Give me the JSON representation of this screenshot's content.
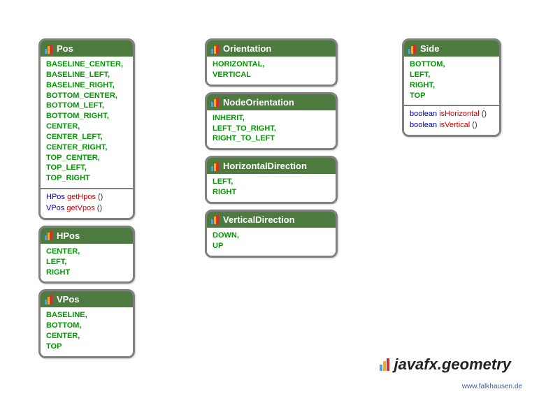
{
  "package_name": "javafx.geometry",
  "watermark": "www.falkhausen.de",
  "col1": [
    {
      "name": "Pos",
      "values": [
        "BASELINE_CENTER,",
        "BASELINE_LEFT,",
        "BASELINE_RIGHT,",
        "BOTTOM_CENTER,",
        "BOTTOM_LEFT,",
        "BOTTOM_RIGHT,",
        "CENTER,",
        "CENTER_LEFT,",
        "CENTER_RIGHT,",
        "TOP_CENTER,",
        "TOP_LEFT,",
        "TOP_RIGHT"
      ],
      "methods": [
        {
          "return": "HPos",
          "name": "getHpos"
        },
        {
          "return": "VPos",
          "name": "getVpos"
        }
      ]
    },
    {
      "name": "HPos",
      "values": [
        "CENTER,",
        "LEFT,",
        "RIGHT"
      ],
      "methods": []
    },
    {
      "name": "VPos",
      "values": [
        "BASELINE,",
        "BOTTOM,",
        "CENTER,",
        "TOP"
      ],
      "methods": []
    }
  ],
  "col2": [
    {
      "name": "Orientation",
      "values": [
        "HORIZONTAL,",
        "VERTICAL"
      ],
      "methods": []
    },
    {
      "name": "NodeOrientation",
      "values": [
        "INHERIT,",
        "LEFT_TO_RIGHT,",
        "RIGHT_TO_LEFT"
      ],
      "methods": []
    },
    {
      "name": "HorizontalDirection",
      "values": [
        "LEFT,",
        "RIGHT"
      ],
      "methods": []
    },
    {
      "name": "VerticalDirection",
      "values": [
        "DOWN,",
        "UP"
      ],
      "methods": []
    }
  ],
  "col3": [
    {
      "name": "Side",
      "values": [
        "BOTTOM,",
        "LEFT,",
        "RIGHT,",
        "TOP"
      ],
      "methods": [
        {
          "return": "boolean",
          "name": "isHorizontal"
        },
        {
          "return": "boolean",
          "name": "isVertical"
        }
      ]
    }
  ]
}
